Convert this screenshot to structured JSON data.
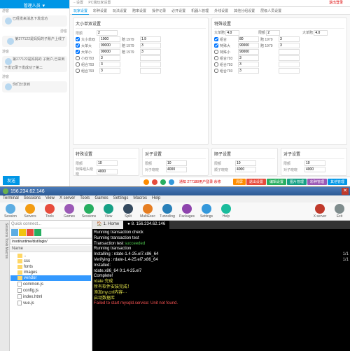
{
  "chat": {
    "header": "管理人员 ▼",
    "messages": [
      {
        "text": "已经发来消息下发成功",
        "side": "l",
        "who": "游客"
      },
      {
        "text": "第277122是妈妈的子账户上线了",
        "side": "r",
        "who": "游客"
      },
      {
        "text": "第277122是妈妈的\n子账户,已来到下发记录下发成功了第二",
        "side": "l",
        "who": "游客"
      },
      {
        "text": "你们分享到",
        "side": "l",
        "who": "游客"
      }
    ],
    "send": "发送"
  },
  "tabs": {
    "t1": "···设置",
    "t2": "PC端玩家设置",
    "logout": "退出登录"
  },
  "nav": [
    "玩家设置",
    "彩种设置",
    "玩法设置",
    "赔率设置",
    "操作记录",
    "必开设置",
    "机器人管理",
    "外线设置",
    "其他分组设置",
    "层级人员设置"
  ],
  "panel_size": {
    "title": "大小单双设置",
    "limit_label": "限额",
    "limit": "2",
    "rows": [
      {
        "on": true,
        "name": "大小单双",
        "pay": "1000",
        "odds_l": "赔 1979",
        "odds": "1.9"
      },
      {
        "on": true,
        "name": "大单大",
        "pay": "90000",
        "odds_l": "赔 1979",
        "odds": "3"
      },
      {
        "on": true,
        "name": "大单小",
        "pay": "90000",
        "odds_l": "赔 1979",
        "odds": "3"
      },
      {
        "on": false,
        "name": "小双793",
        "pay": "3",
        "odds_l": "",
        "odds": ""
      },
      {
        "on": false,
        "name": "组合793",
        "pay": "3",
        "odds_l": "",
        "odds": ""
      },
      {
        "on": false,
        "name": "组合793",
        "pay": "3",
        "odds_l": "",
        "odds": ""
      }
    ]
  },
  "panel_special": {
    "title": "特殊设置",
    "cols": [
      {
        "label": "大单赔",
        "v": "4.0"
      },
      {
        "label": "限额",
        "v": "2"
      },
      {
        "label": "大单赔",
        "v": "4.0"
      }
    ],
    "rows": [
      {
        "on": true,
        "name": "组合",
        "pay": "80",
        "odds_l": "赔 1979",
        "odds": "3"
      },
      {
        "on": true,
        "name": "特殊大",
        "pay": "90000",
        "odds_l": "赔 1979",
        "odds": "3"
      },
      {
        "on": false,
        "name": "特殊小",
        "pay": "90000",
        "odds_l": "",
        "odds": ""
      },
      {
        "on": false,
        "name": "组合793",
        "pay": "3",
        "odds_l": "",
        "odds": ""
      },
      {
        "on": false,
        "name": "组合793",
        "pay": "3",
        "odds_l": "",
        "odds": ""
      },
      {
        "on": false,
        "name": "组合793",
        "pay": "3",
        "odds_l": "",
        "odds": ""
      }
    ]
  },
  "panel_b1": {
    "title": "特殊设置",
    "l1": "限额",
    "v1": "10",
    "l2": "特殊组头晓晓",
    "v2": "4000"
  },
  "panel_b2": {
    "title": "对子设置",
    "l1": "限额",
    "v1": "10",
    "l2": "对子晓晓",
    "v2": "4000"
  },
  "panel_b3": {
    "title": "顺子设置",
    "l1": "限额",
    "v1": "10",
    "l2": "顺子晓晓",
    "v2": "4000"
  },
  "panel_b4": {
    "title": "对子设置",
    "l1": "限额",
    "v1": "10",
    "l2": "对子晓晓",
    "v2": "4000"
  },
  "footer": {
    "info": "通知 277188用户登录 余修",
    "btns": [
      "清屏",
      "退出设置",
      "编辑设置",
      "图片管理",
      "彩种管理",
      "其他管理"
    ]
  },
  "ssh": {
    "ip": "156.234.62.146",
    "menu": [
      "Terminal",
      "Sessions",
      "View",
      "X server",
      "Tools",
      "Games",
      "Settings",
      "Macros",
      "Help"
    ],
    "toolbar": [
      {
        "n": "Session",
        "c": "#5dade2"
      },
      {
        "n": "Servers",
        "c": "#f39c12"
      },
      {
        "n": "Tools",
        "c": "#e74c3c"
      },
      {
        "n": "Games",
        "c": "#9b59b6"
      },
      {
        "n": "Sessions",
        "c": "#27ae60"
      },
      {
        "n": "View",
        "c": "#16a085"
      },
      {
        "n": "Split",
        "c": "#34495e"
      },
      {
        "n": "MultiExec",
        "c": "#e67e22"
      },
      {
        "n": "Tunneling",
        "c": "#2980b9"
      },
      {
        "n": "Packages",
        "c": "#8e44ad"
      },
      {
        "n": "Settings",
        "c": "#3498db"
      },
      {
        "n": "Help",
        "c": "#1abc9c"
      },
      {
        "n": "",
        "c": ""
      },
      {
        "n": "X server",
        "c": "#c0392b"
      },
      {
        "n": "Exit",
        "c": "#7f8c8d"
      }
    ],
    "sidetabs": [
      "Sessions",
      "Tools",
      "Macros"
    ],
    "qc": "Quick connect...",
    "path": "/root/runtime/dist/login/",
    "col": "Name",
    "files": [
      {
        "n": "..",
        "t": "up"
      },
      {
        "n": "css",
        "t": "d"
      },
      {
        "n": "fonts",
        "t": "d"
      },
      {
        "n": "images",
        "t": "d"
      },
      {
        "n": "vendor",
        "t": "d",
        "sel": true
      },
      {
        "n": "common.js",
        "t": "f"
      },
      {
        "n": "config.js",
        "t": "f"
      },
      {
        "n": "index.html",
        "t": "f"
      },
      {
        "n": "vue.js",
        "t": "f"
      }
    ],
    "term_tabs": {
      "home": "1. Home",
      "active": "8. 156.234.62.146"
    },
    "term_lines": [
      {
        "c": "w",
        "t": "Running transaction check"
      },
      {
        "c": "w",
        "t": "Running transaction test"
      },
      {
        "c": "w",
        "t": "Transaction test ",
        "suf": "succeeded",
        "sc": "g"
      },
      {
        "c": "w",
        "t": "Running transaction"
      },
      {
        "c": "w",
        "t": "  Installing : rdate-1.4-25.el7.x86_64",
        "r": "1/1"
      },
      {
        "c": "w",
        "t": "  Verifying  : rdate-1.4-25.el7.x86_64",
        "r": "1/1"
      },
      {
        "c": "w",
        "t": ""
      },
      {
        "c": "w",
        "t": "Installed:"
      },
      {
        "c": "w",
        "t": "  rdate.x86_64 0:1.4-25.el7"
      },
      {
        "c": "w",
        "t": ""
      },
      {
        "c": "w",
        "t": "Complete!"
      },
      {
        "c": "y",
        "t": "rdate 完成"
      },
      {
        "c": "y",
        "t": "所有软件安装完成！"
      },
      {
        "c": "y",
        "t": "添加my.cnf内容···"
      },
      {
        "c": "y",
        "t": "启动数据库"
      },
      {
        "c": "r",
        "t": "Failed to start mysqld.service: Unit not found."
      }
    ]
  }
}
